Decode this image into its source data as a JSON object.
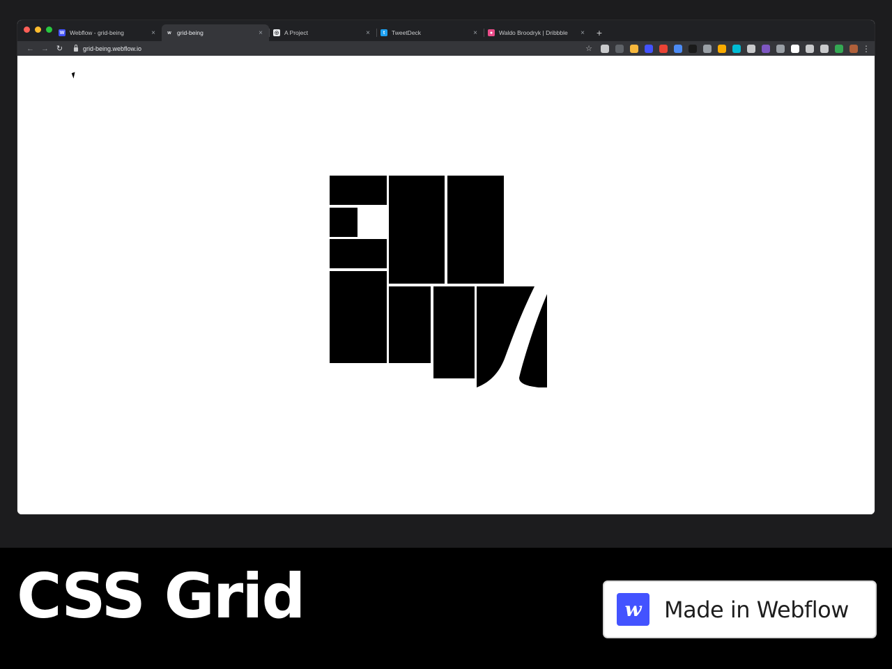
{
  "browser": {
    "tabs": [
      {
        "title": "Webflow - grid-being",
        "favicon": "webflow-icon",
        "favicon_glyph": "W",
        "favicon_color": "#4353ff",
        "active": false
      },
      {
        "title": "grid-being",
        "favicon": "webflow-icon",
        "favicon_glyph": "w",
        "favicon_color": "#35363a",
        "active": true
      },
      {
        "title": "A Project",
        "favicon": "project-icon",
        "favicon_glyph": "◎",
        "favicon_color": "#e8eaed",
        "active": false
      },
      {
        "title": "TweetDeck",
        "favicon": "tweetdeck-icon",
        "favicon_glyph": "t",
        "favicon_color": "#1da1f2",
        "active": false
      },
      {
        "title": "Waldo Broodryk | Dribbble",
        "favicon": "dribbble-icon",
        "favicon_glyph": "●",
        "favicon_color": "#ea4c89",
        "active": false
      }
    ],
    "close_glyph": "×",
    "new_tab_glyph": "+",
    "url": "grid-being.webflow.io",
    "back_glyph": "←",
    "forward_glyph": "→",
    "reload_glyph": "↻",
    "star_glyph": "☆",
    "menu_glyph": "⋮",
    "extensions": [
      "#c9cacc",
      "#5f6368",
      "#f6b73c",
      "#4353ff",
      "#ea4335",
      "#4c8bf5",
      "#1a1a1a",
      "#9aa0a6",
      "#f9ab00",
      "#00bcd4",
      "#c9cacc",
      "#7e57c2",
      "#9aa0a6",
      "#ffffff",
      "#c9cacc",
      "#c9cacc",
      "#34a853",
      "#b0603a"
    ]
  },
  "footer": {
    "title": "CSS Grid",
    "badge_logo": "w",
    "badge_text": "Made in Webflow"
  },
  "colors": {
    "accent": "#4353ff",
    "traffic_red": "#ff5f57",
    "traffic_yellow": "#febc2e",
    "traffic_green": "#28c840"
  }
}
